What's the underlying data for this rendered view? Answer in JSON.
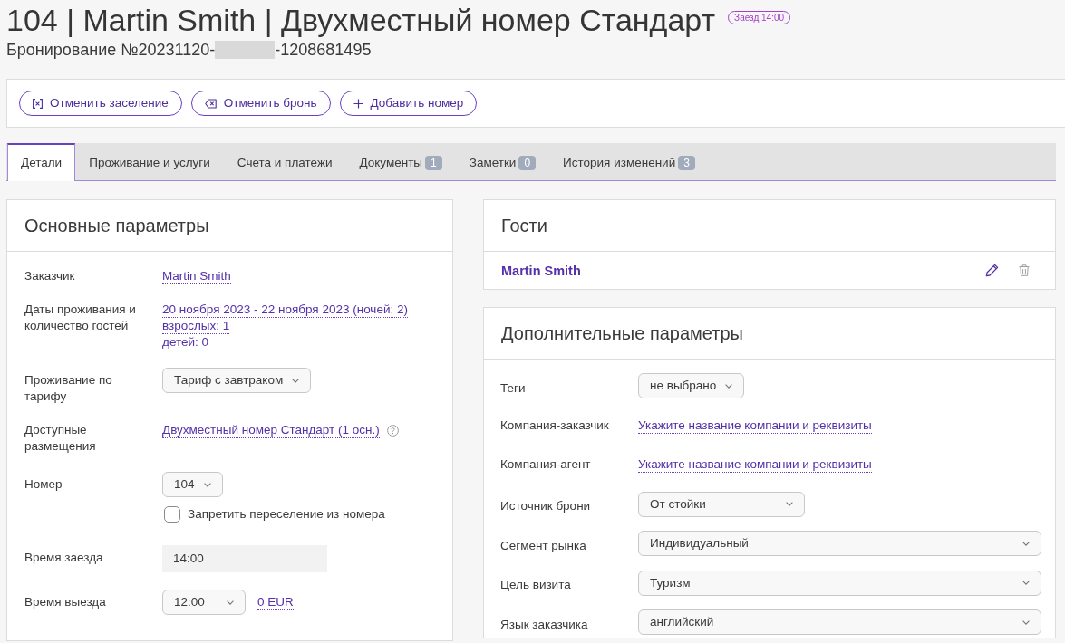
{
  "header": {
    "title": "104 | Martin Smith | Двухместный номер Стандарт",
    "badge": "Заезд 14:00",
    "booking": {
      "prefix": "Бронирование №20231120-",
      "redacted": true,
      "suffix": "-1208681495"
    }
  },
  "actions": [
    {
      "label": "Отменить заселение",
      "kind": "cancel"
    },
    {
      "label": "Отменить бронь",
      "kind": "erase"
    },
    {
      "label": "Добавить номер",
      "kind": "add"
    }
  ],
  "tabs": [
    {
      "label": "Детали",
      "selected": true
    },
    {
      "label": "Проживание и услуги",
      "selected": false
    },
    {
      "label": "Счета и платежи",
      "selected": false
    },
    {
      "label": "Документы",
      "count": "1",
      "selected": false
    },
    {
      "label": "Заметки",
      "count": "0",
      "selected": false
    },
    {
      "label": "История изменений",
      "count": "3",
      "selected": false
    }
  ],
  "main_params": {
    "title": "Основные параметры",
    "rows": [
      {
        "label": "Заказчик",
        "kind": "links",
        "values": [
          "Martin Smith"
        ]
      },
      {
        "label": "Даты проживания и количество гостей",
        "kind": "links",
        "values": [
          "20 ноября 2023 - 22 ноября 2023 (ночей: 2)",
          "взрослых: 1",
          "детей: 0"
        ]
      },
      {
        "label": "Проживание по тарифу",
        "kind": "dropdown",
        "value": "Тариф с завтраком"
      },
      {
        "label": "Доступные размещения",
        "kind": "links",
        "values": [
          "Двухместный номер Стандарт (1 осн.)"
        ],
        "help": true
      },
      {
        "label": "Номер",
        "kind": "dropdown",
        "value": "104",
        "checkbox": {
          "label": "Запретить переселение из номера",
          "checked": false
        }
      },
      {
        "label": "Время заезда",
        "kind": "readonly",
        "value": "14:00"
      },
      {
        "label": "Время выезда",
        "kind": "select",
        "value": "12:00",
        "full": false,
        "link": "0 EUR"
      }
    ]
  },
  "guests": {
    "title": "Гости",
    "items": [
      {
        "name": "Martin Smith"
      }
    ]
  },
  "extra_params": {
    "title": "Дополнительные параметры",
    "rows": [
      {
        "label": "Теги",
        "kind": "dropdown",
        "value": "не выбрано"
      },
      {
        "label": "Компания-заказчик",
        "kind": "links",
        "values": [
          "Укажите название компании и реквизиты"
        ]
      },
      {
        "label": "Компания-агент",
        "kind": "links",
        "values": [
          "Укажите название компании и реквизиты"
        ]
      },
      {
        "label": "Источник брони",
        "kind": "select",
        "value": "От стойки",
        "full": false
      },
      {
        "label": "Сегмент рынка",
        "kind": "select",
        "value": "Индивидуальный",
        "full": true
      },
      {
        "label": "Цель визита",
        "kind": "select",
        "value": "Туризм",
        "full": true
      },
      {
        "label": "Язык заказчика",
        "kind": "select",
        "value": "английский",
        "full": true
      }
    ]
  }
}
